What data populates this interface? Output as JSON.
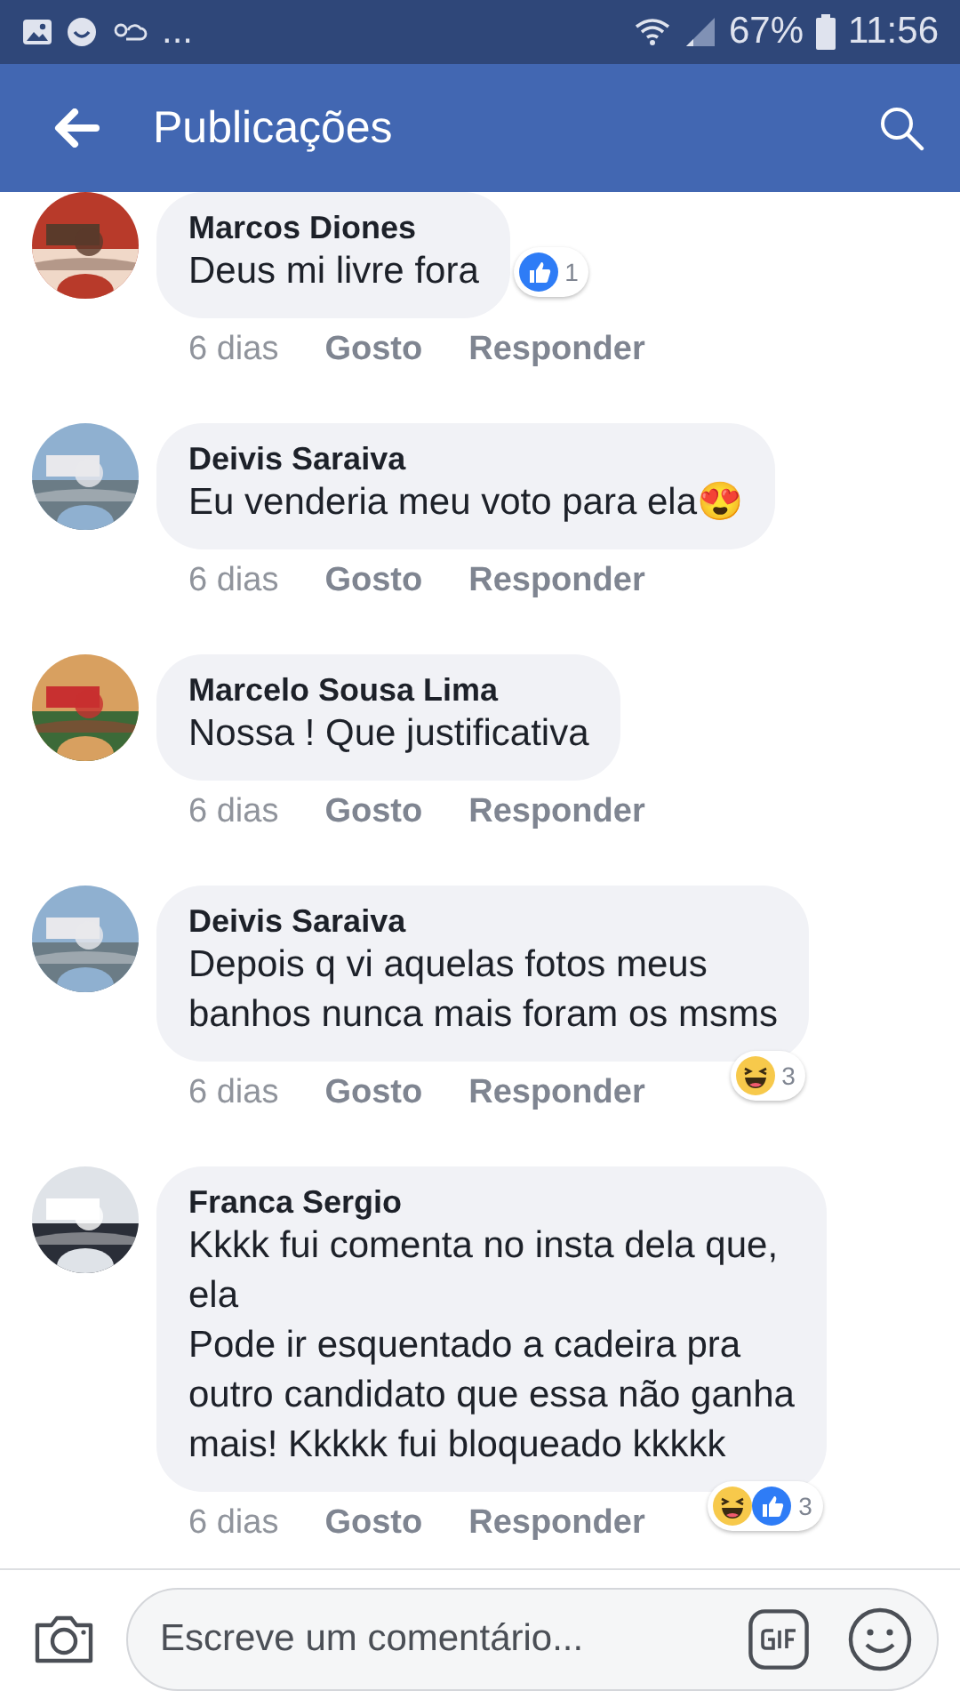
{
  "status_bar": {
    "overflow": "...",
    "battery": "67%",
    "time": "11:56"
  },
  "app_bar": {
    "title": "Publicações"
  },
  "comments": [
    {
      "author": "Marcos Diones",
      "text": "Deus mi livre fora",
      "time": "6 dias",
      "like": "Gosto",
      "reply": "Responder",
      "reactions": {
        "icons": [
          {
            "kind": "like"
          }
        ],
        "count": "1"
      }
    },
    {
      "author": "Deivis Saraiva",
      "text": "Eu venderia meu voto para ela😍",
      "time": "6 dias",
      "like": "Gosto",
      "reply": "Responder"
    },
    {
      "author": "Marcelo Sousa Lima",
      "text": "Nossa ! Que justificativa",
      "time": "6 dias",
      "like": "Gosto",
      "reply": "Responder"
    },
    {
      "author": "Deivis Saraiva",
      "text": "Depois q vi aquelas fotos meus\nbanhos nunca mais foram os msms",
      "time": "6 dias",
      "like": "Gosto",
      "reply": "Responder",
      "reactions": {
        "icons": [
          {
            "kind": "haha"
          }
        ],
        "count": "3"
      }
    },
    {
      "author": "Franca Sergio",
      "text": "Kkkk fui comenta no insta dela que,\nela\nPode ir esquentado a cadeira pra\noutro candidato que essa não ganha\nmais! Kkkkk fui bloqueado kkkkk",
      "time": "6 dias",
      "like": "Gosto",
      "reply": "Responder",
      "reactions": {
        "icons": [
          {
            "kind": "haha"
          },
          {
            "kind": "like"
          }
        ],
        "count": "3"
      }
    }
  ],
  "composer": {
    "placeholder": "Escreve um comentário..."
  }
}
